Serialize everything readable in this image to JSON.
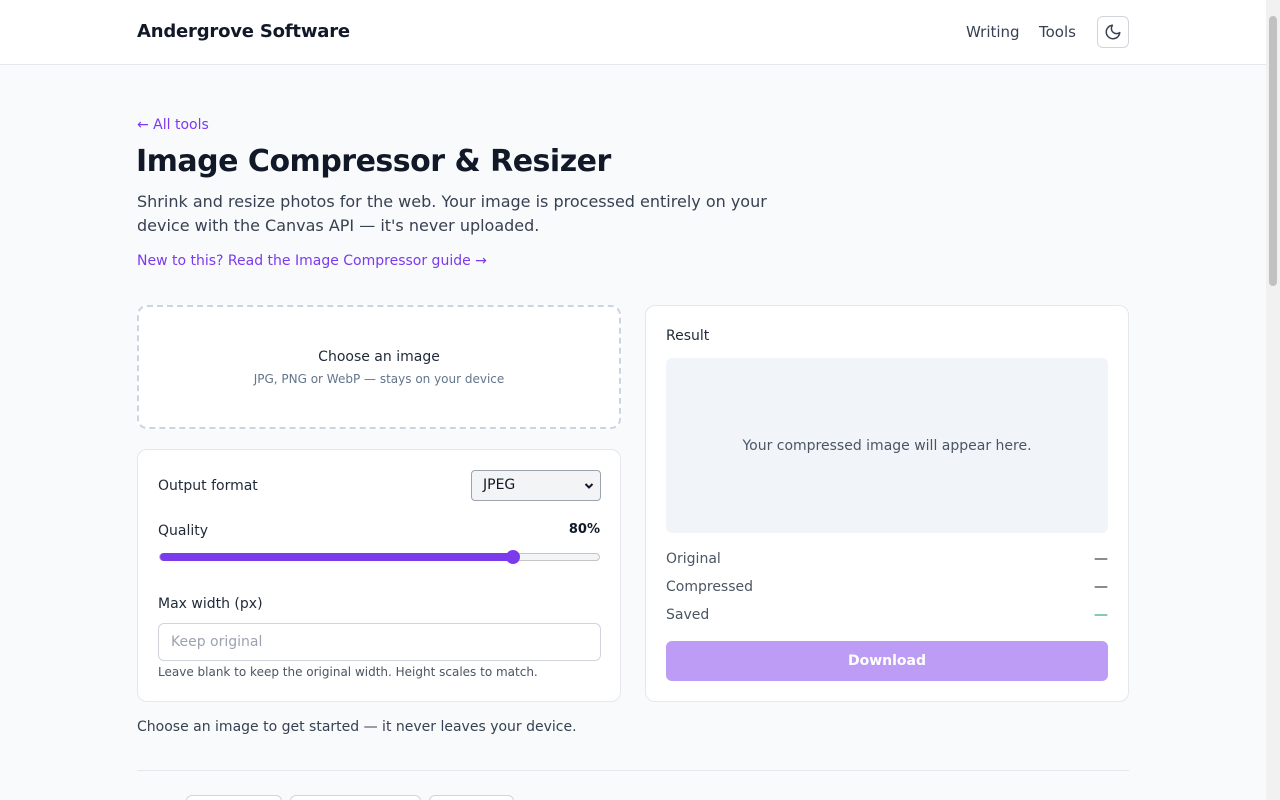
{
  "header": {
    "brand": "Andergrove Software",
    "nav": {
      "writing": "Writing",
      "tools": "Tools"
    },
    "theme_toggle_icon": "moon-icon"
  },
  "page": {
    "back_link": "← All tools",
    "title": "Image Compressor & Resizer",
    "description": "Shrink and resize photos for the web. Your image is processed entirely on your device with the Canvas API — it's never uploaded.",
    "guide_link": "New to this? Read the Image Compressor guide →"
  },
  "dropzone": {
    "title": "Choose an image",
    "subtitle": "JPG, PNG or WebP — stays on your device"
  },
  "settings": {
    "format_label": "Output format",
    "format_value": "JPEG",
    "quality_label": "Quality",
    "quality_value": "80%",
    "quality_fraction": 0.8,
    "max_width_label": "Max width (px)",
    "max_width_placeholder": "Keep original",
    "max_width_hint": "Leave blank to keep the original width. Height scales to match."
  },
  "result": {
    "title": "Result",
    "placeholder": "Your compressed image will appear here.",
    "stats": [
      {
        "label": "Original",
        "value": "—"
      },
      {
        "label": "Compressed",
        "value": "—"
      },
      {
        "label": "Saved",
        "value": "—"
      }
    ],
    "download_label": "Download"
  },
  "status_text": "Choose an image to get started — it never leaves your device.",
  "colors": {
    "accent": "#7c3aed",
    "download_disabled": "#bc9cf5",
    "saved": "#059669"
  }
}
